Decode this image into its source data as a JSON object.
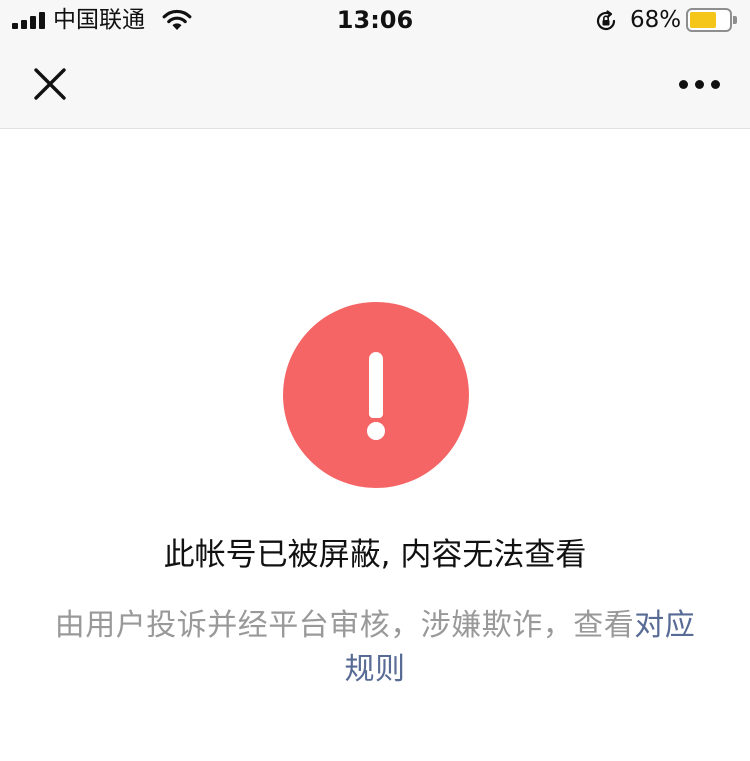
{
  "status_bar": {
    "carrier": "中国联通",
    "time": "13:06",
    "battery_percent_text": "68%",
    "battery_level": 0.68,
    "icons": [
      "signal-icon",
      "wifi-icon",
      "rotation-lock-icon",
      "battery-icon"
    ]
  },
  "nav_bar": {
    "close_icon": "close-icon",
    "more_icon": "more-dots-icon"
  },
  "main": {
    "alert_icon": "exclamation-circle-icon",
    "title": "此帐号已被屏蔽, 内容无法查看",
    "description": "由用户投诉并经平台审核，涉嫌欺诈，查看",
    "link_text": "对应规则"
  },
  "colors": {
    "alert_red": "#f56565",
    "link_blue": "#576b95",
    "muted_text": "#999999",
    "battery_yellow": "#f5c518"
  }
}
